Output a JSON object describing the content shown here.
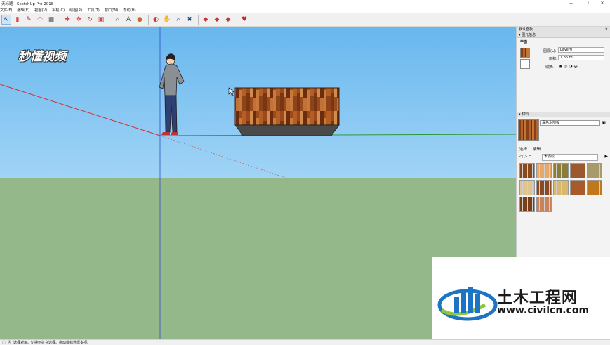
{
  "window": {
    "title": "无标题 - SketchUp Pro 2018",
    "controls": [
      "—",
      "❐",
      "✕"
    ]
  },
  "menu": [
    "文件(F)",
    "编辑(E)",
    "视图(V)",
    "相机(C)",
    "绘图(R)",
    "工具(T)",
    "窗口(W)",
    "帮助(H)"
  ],
  "toolbar": {
    "icons": [
      "select-icon",
      "eraser-icon",
      "pencil-icon",
      "arc-icon",
      "rectangle-icon",
      "push-pull-icon",
      "move-icon",
      "rotate-icon",
      "scale-icon",
      "offset-icon",
      "tape-icon",
      "text-icon",
      "paint-icon",
      "orbit-icon",
      "pan-icon",
      "zoom-icon",
      "zoom-extents-icon",
      "warehouse-icon",
      "extension-icon",
      "layout-icon",
      "ruby-icon"
    ]
  },
  "watermark": {
    "text": "秒懂视频"
  },
  "panel": {
    "tray_title": "默认面板",
    "entity": {
      "section_title": "图元信息",
      "type": "平面",
      "layer_label": "图层(L):",
      "layer_value": "Layer0",
      "area_label": "面积:",
      "area_value": "1.36 m²",
      "toggle_label": "切换:"
    },
    "materials": {
      "section_title": "材料",
      "material_name": "深色木地板",
      "tabs": [
        "选择",
        "编辑"
      ],
      "library": "木质纹",
      "swatches": [
        "#8b4a1d",
        "#e8a86a",
        "#8a7d3a",
        "#9a5a2e",
        "#a89a6c",
        "#e0c48c",
        "#8c4a22",
        "#d8b86a",
        "#a85a2a",
        "#c0781c",
        "#7a3e18",
        "#c88458"
      ]
    }
  },
  "logo": {
    "title": "土木工程网",
    "url": "www.civilcn.com"
  },
  "status": {
    "text": "选择对象。切换到扩充选择。拖动鼠标选择多项。"
  }
}
